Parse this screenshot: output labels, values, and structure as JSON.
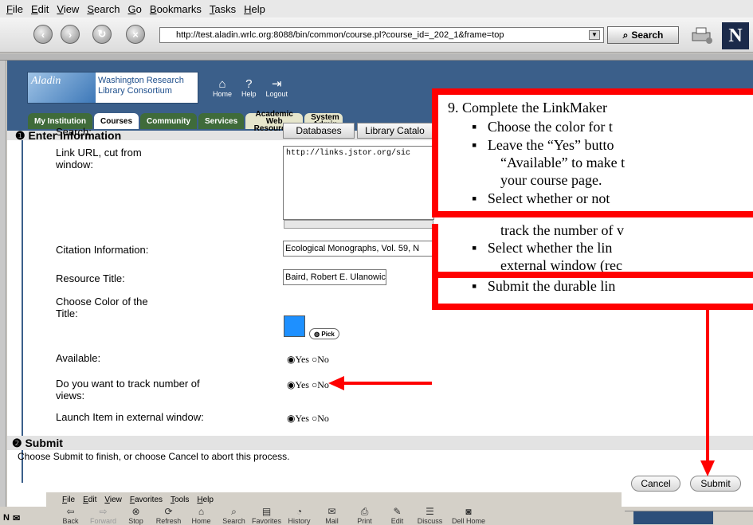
{
  "browser": {
    "menu": [
      "File",
      "Edit",
      "View",
      "Search",
      "Go",
      "Bookmarks",
      "Tasks",
      "Help"
    ],
    "url": "http://test.aladin.wrlc.org:8088/bin/common/course.pl?course_id=_202_1&frame=top",
    "search_label": "Search",
    "throbber_letter": "N"
  },
  "site": {
    "logo_text": "Aladin",
    "org_line1": "Washington Research",
    "org_line2": "Library Consortium",
    "top_icons": [
      {
        "label": "Home",
        "icon": "home-icon"
      },
      {
        "label": "Help",
        "icon": "help-icon"
      },
      {
        "label": "Logout",
        "icon": "logout-icon"
      }
    ],
    "tabs": [
      {
        "label": "My Institution"
      },
      {
        "label": "Courses"
      },
      {
        "label": "Community"
      },
      {
        "label": "Services"
      },
      {
        "label": "Academic Web Resources"
      },
      {
        "label": "System Admin"
      }
    ]
  },
  "form": {
    "section1": "Enter Information",
    "search_label": "Search:",
    "databases_btn": "Databases",
    "library_btn": "Library Catalo",
    "link_url_label": "Link URL, cut from window:",
    "link_url_value": "http://links.jstor.org/sic",
    "citation_label": "Citation Information:",
    "citation_value": "Ecological Monographs, Vol. 59, N",
    "resource_title_label": "Resource Title:",
    "resource_title_value": "Baird, Robert E. Ulanowicz",
    "color_label": "Choose Color of the Title:",
    "pick_label": "Pick",
    "available_label": "Available:",
    "track_label": "Do you want to track number of views:",
    "launch_label": "Launch Item in external window:",
    "yes": "Yes",
    "no": "No",
    "section2": "Submit",
    "submit_desc": "Choose Submit to finish, or choose Cancel to abort this process.",
    "cancel_btn": "Cancel",
    "submit_btn": "Submit"
  },
  "callout": {
    "heading": "9. Complete the LinkMaker",
    "bullets": [
      "Choose the color for t",
      "Leave the “Yes” butto",
      "“Available” to make t",
      "your course page.",
      "Select whether or not",
      "track the number of v",
      "Select whether the lin",
      "external window (rec",
      "Submit the durable lin"
    ]
  },
  "nested_window": {
    "menu": [
      "File",
      "Edit",
      "View",
      "Favorites",
      "Tools",
      "Help"
    ],
    "toolbar": [
      "Back",
      "Forward",
      "Stop",
      "Refresh",
      "Home",
      "Search",
      "Favorites",
      "History",
      "Mail",
      "Print",
      "Edit",
      "Discuss",
      "Dell Home"
    ]
  },
  "colors": {
    "banner": "#3b5f8a",
    "tab_green": "#3f6b3a",
    "callout_border": "#ff0000",
    "swatch": "#1e90ff"
  }
}
